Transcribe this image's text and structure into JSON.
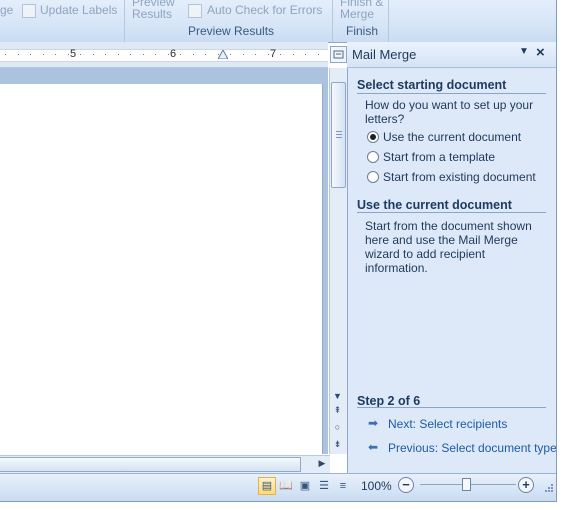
{
  "ribbon": {
    "update_labels": "Update Labels",
    "preview_results_btn": "Preview Results",
    "auto_check": "Auto Check for Errors",
    "finish_merge": "Finish & Merge",
    "group_preview": "Preview Results",
    "group_finish": "Finish"
  },
  "ruler": {
    "labels": [
      "5",
      "6",
      "7"
    ]
  },
  "task_pane": {
    "title": "Mail Merge",
    "section1": {
      "title": "Select starting document",
      "question": "How do you want to set up your letters?",
      "options": [
        {
          "label": "Use the current document",
          "selected": true
        },
        {
          "label": "Start from a template",
          "selected": false
        },
        {
          "label": "Start from existing document",
          "selected": false
        }
      ]
    },
    "section2": {
      "title": "Use the current document",
      "description": "Start from the document shown here and use the Mail Merge wizard to add recipient information."
    },
    "step": "Step 2 of 6",
    "next_link": "Next: Select recipients",
    "previous_link": "Previous: Select document type"
  },
  "status_bar": {
    "zoom": "100%",
    "zoom_fraction": 0.5
  },
  "icons": {
    "close": "close-icon",
    "dropdown": "chevron-down-icon",
    "zoom_in": "plus-icon",
    "zoom_out": "minus-icon"
  }
}
